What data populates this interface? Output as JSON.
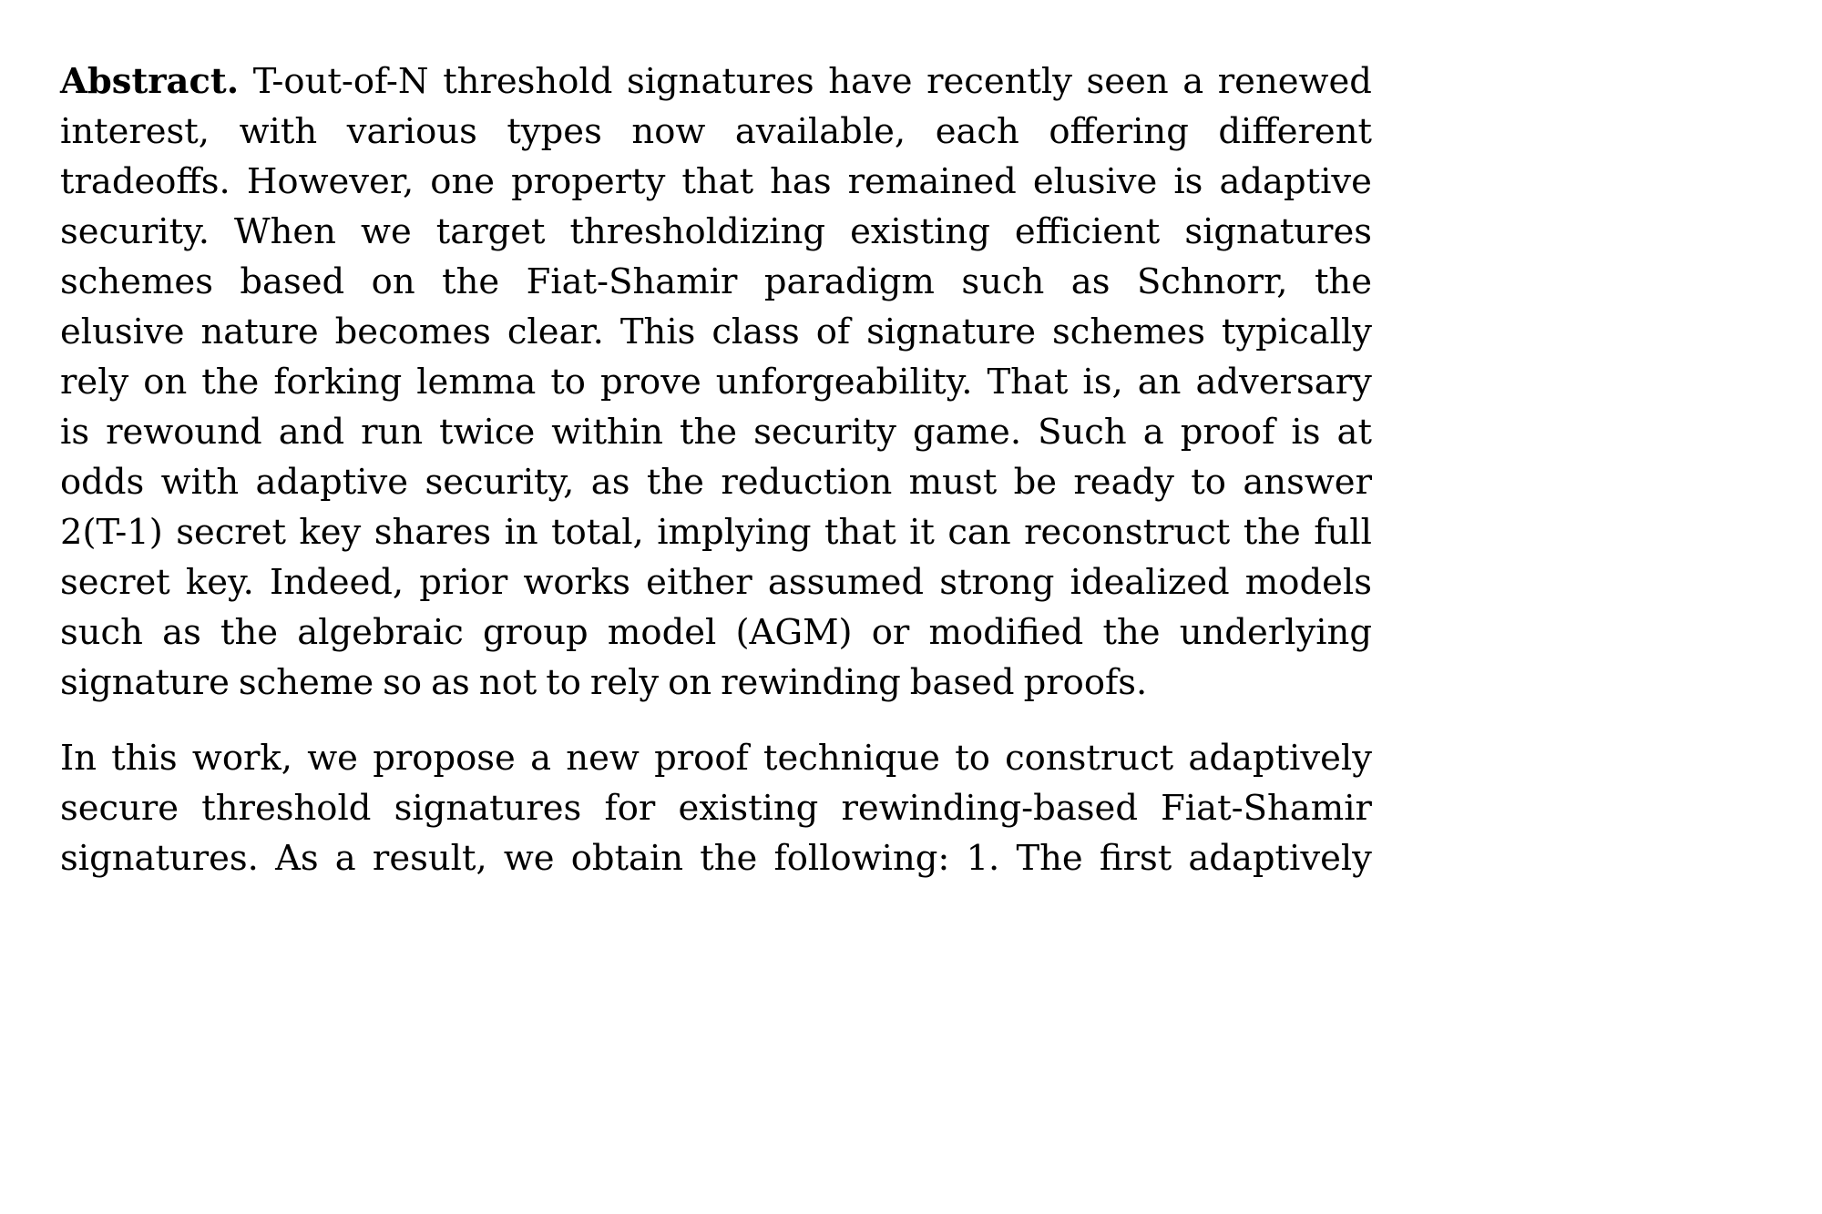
{
  "document": {
    "type": "paper-abstract",
    "background_color": "#ffffff",
    "text_color": "#000000",
    "alignment": "justified",
    "paragraphs": [
      {
        "id": "abstract",
        "lead_label": "Abstract.",
        "text": "Abstract. T-out-of-N threshold signatures have recently seen a renewed interest, with various types now available, each offering different tradeoffs. However, one property that has remained elusive is adaptive security. When we target thresholdizing existing efficient signatures schemes based on the Fiat-Shamir paradigm such as Schnorr, the elusive nature becomes clear. This class of signature schemes typically rely on the forking lemma to prove unforgeability. That is, an adversary is rewound and run twice within the security game. Such a proof is at odds with adaptive security, as the reduction must be ready to answer 2(T-1) secret key shares in total, implying that it can reconstruct the full secret key. Indeed, prior works either assumed strong idealized models such as the algebraic group model (AGM) or modified the underlying signature scheme so as not to rely on rewinding based proofs.",
        "lines": [
          {
            "justify": true,
            "words": [
              {
                "t": "Abstract.",
                "bold": true
              },
              {
                "t": "T-out-of-N"
              },
              {
                "t": "threshold"
              },
              {
                "t": "signatures"
              },
              {
                "t": "have"
              },
              {
                "t": "recently"
              },
              {
                "t": "seen"
              },
              {
                "t": "a"
              },
              {
                "t": "renewed"
              }
            ]
          },
          {
            "justify": true,
            "words": [
              {
                "t": "interest,"
              },
              {
                "t": "with"
              },
              {
                "t": "various"
              },
              {
                "t": "types"
              },
              {
                "t": "now"
              },
              {
                "t": "available,"
              },
              {
                "t": "each"
              },
              {
                "t": "offering"
              },
              {
                "t": "different"
              }
            ]
          },
          {
            "justify": true,
            "words": [
              {
                "t": "tradeoffs."
              },
              {
                "t": "However,"
              },
              {
                "t": "one"
              },
              {
                "t": "property"
              },
              {
                "t": "that"
              },
              {
                "t": "has"
              },
              {
                "t": "remained"
              },
              {
                "t": "elusive"
              },
              {
                "t": "is"
              },
              {
                "t": "adaptive"
              }
            ]
          },
          {
            "justify": true,
            "words": [
              {
                "t": "security."
              },
              {
                "t": "When"
              },
              {
                "t": "we"
              },
              {
                "t": "target"
              },
              {
                "t": "thresholdizing"
              },
              {
                "t": "existing"
              },
              {
                "t": "efficient"
              },
              {
                "t": "signatures"
              }
            ]
          },
          {
            "justify": true,
            "words": [
              {
                "t": "schemes"
              },
              {
                "t": "based"
              },
              {
                "t": "on"
              },
              {
                "t": "the"
              },
              {
                "t": "Fiat-Shamir"
              },
              {
                "t": "paradigm"
              },
              {
                "t": "such"
              },
              {
                "t": "as"
              },
              {
                "t": "Schnorr,"
              },
              {
                "t": "the"
              }
            ]
          },
          {
            "justify": true,
            "words": [
              {
                "t": "elusive"
              },
              {
                "t": "nature"
              },
              {
                "t": "becomes"
              },
              {
                "t": "clear."
              },
              {
                "t": "This"
              },
              {
                "t": "class"
              },
              {
                "t": "of"
              },
              {
                "t": "signature"
              },
              {
                "t": "schemes"
              },
              {
                "t": "typically"
              }
            ]
          },
          {
            "justify": true,
            "words": [
              {
                "t": "rely"
              },
              {
                "t": "on"
              },
              {
                "t": "the"
              },
              {
                "t": "forking"
              },
              {
                "t": "lemma"
              },
              {
                "t": "to"
              },
              {
                "t": "prove"
              },
              {
                "t": "unforgeability."
              },
              {
                "t": "That"
              },
              {
                "t": "is,"
              },
              {
                "t": "an"
              },
              {
                "t": "adversary"
              }
            ]
          },
          {
            "justify": true,
            "words": [
              {
                "t": "is"
              },
              {
                "t": "rewound"
              },
              {
                "t": "and"
              },
              {
                "t": "run"
              },
              {
                "t": "twice"
              },
              {
                "t": "within"
              },
              {
                "t": "the"
              },
              {
                "t": "security"
              },
              {
                "t": "game."
              },
              {
                "t": "Such"
              },
              {
                "t": "a"
              },
              {
                "t": "proof"
              },
              {
                "t": "is"
              },
              {
                "t": "at"
              }
            ]
          },
          {
            "justify": true,
            "words": [
              {
                "t": "odds"
              },
              {
                "t": "with"
              },
              {
                "t": "adaptive"
              },
              {
                "t": "security,"
              },
              {
                "t": "as"
              },
              {
                "t": "the"
              },
              {
                "t": "reduction"
              },
              {
                "t": "must"
              },
              {
                "t": "be"
              },
              {
                "t": "ready"
              },
              {
                "t": "to"
              },
              {
                "t": "answer"
              }
            ]
          },
          {
            "justify": true,
            "words": [
              {
                "t": "2(T-1)",
                "math": true
              },
              {
                "t": "secret"
              },
              {
                "t": "key"
              },
              {
                "t": "shares"
              },
              {
                "t": "in"
              },
              {
                "t": "total,"
              },
              {
                "t": "implying"
              },
              {
                "t": "that"
              },
              {
                "t": "it"
              },
              {
                "t": "can"
              },
              {
                "t": "reconstruct"
              },
              {
                "t": "the"
              },
              {
                "t": "full"
              }
            ]
          },
          {
            "justify": true,
            "words": [
              {
                "t": "secret"
              },
              {
                "t": "key."
              },
              {
                "t": "Indeed,"
              },
              {
                "t": "prior"
              },
              {
                "t": "works"
              },
              {
                "t": "either"
              },
              {
                "t": "assumed"
              },
              {
                "t": "strong"
              },
              {
                "t": "idealized"
              },
              {
                "t": "models"
              }
            ]
          },
          {
            "justify": true,
            "words": [
              {
                "t": "such"
              },
              {
                "t": "as"
              },
              {
                "t": "the"
              },
              {
                "t": "algebraic"
              },
              {
                "t": "group"
              },
              {
                "t": "model"
              },
              {
                "t": "(AGM)"
              },
              {
                "t": "or"
              },
              {
                "t": "modified"
              },
              {
                "t": "the"
              },
              {
                "t": "underlying"
              }
            ]
          },
          {
            "justify": false,
            "words": [
              {
                "t": "signature"
              },
              {
                "t": "scheme"
              },
              {
                "t": "so"
              },
              {
                "t": "as"
              },
              {
                "t": "not"
              },
              {
                "t": "to"
              },
              {
                "t": "rely"
              },
              {
                "t": "on"
              },
              {
                "t": "rewinding"
              },
              {
                "t": "based"
              },
              {
                "t": "proofs."
              }
            ]
          }
        ]
      },
      {
        "id": "contributions",
        "text": "In this work, we propose a new proof technique to construct adaptively secure threshold signatures for existing rewinding-based Fiat-Shamir signatures. As a result, we obtain the following: 1. The first adaptively",
        "lines": [
          {
            "justify": true,
            "words": [
              {
                "t": "In"
              },
              {
                "t": "this"
              },
              {
                "t": "work,"
              },
              {
                "t": "we"
              },
              {
                "t": "propose"
              },
              {
                "t": "a"
              },
              {
                "t": "new"
              },
              {
                "t": "proof"
              },
              {
                "t": "technique"
              },
              {
                "t": "to"
              },
              {
                "t": "construct"
              },
              {
                "t": "adaptively"
              }
            ]
          },
          {
            "justify": true,
            "words": [
              {
                "t": "secure"
              },
              {
                "t": "threshold"
              },
              {
                "t": "signatures"
              },
              {
                "t": "for"
              },
              {
                "t": "existing"
              },
              {
                "t": "rewinding-based"
              },
              {
                "t": "Fiat-Shamir"
              }
            ]
          },
          {
            "justify": true,
            "words": [
              {
                "t": "signatures."
              },
              {
                "t": "As"
              },
              {
                "t": "a"
              },
              {
                "t": "result,"
              },
              {
                "t": "we"
              },
              {
                "t": "obtain"
              },
              {
                "t": "the"
              },
              {
                "t": "following:"
              },
              {
                "t": "1."
              },
              {
                "t": "The"
              },
              {
                "t": "first"
              },
              {
                "t": "adaptively"
              }
            ]
          }
        ]
      }
    ]
  }
}
